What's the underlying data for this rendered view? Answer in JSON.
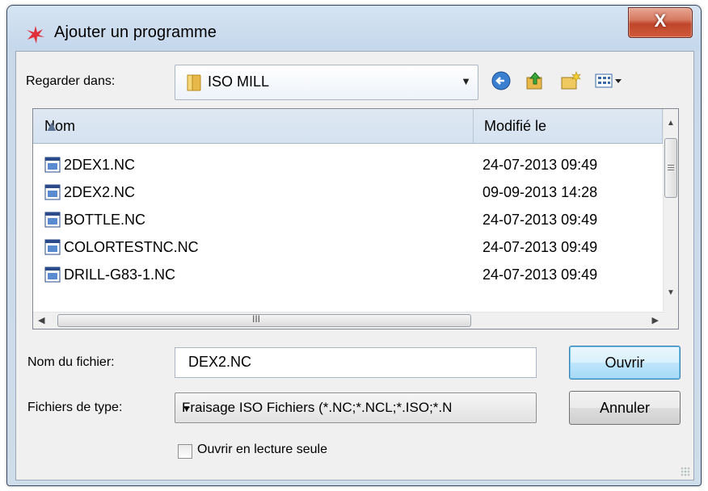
{
  "window": {
    "title": "Ajouter un programme",
    "close_label": "X"
  },
  "lookin": {
    "label": "Regarder dans:",
    "value": "ISO MILL"
  },
  "toolbar": {
    "icons": [
      "back-icon",
      "up-folder-icon",
      "new-folder-icon",
      "view-menu-icon"
    ]
  },
  "list": {
    "columns": [
      "Nom",
      "Modifié le"
    ],
    "rows": [
      {
        "name": "2DEX1.NC",
        "date": "24-07-2013 09:49"
      },
      {
        "name": "2DEX2.NC",
        "date": "09-09-2013 14:28"
      },
      {
        "name": "BOTTLE.NC",
        "date": "24-07-2013 09:49"
      },
      {
        "name": "COLORTESTNC.NC",
        "date": "24-07-2013 09:49"
      },
      {
        "name": "DRILL-G83-1.NC",
        "date": "24-07-2013 09:49"
      }
    ]
  },
  "filename": {
    "label": "Nom du fichier:",
    "value": "DEX2.NC"
  },
  "filetype": {
    "label": "Fichiers de type:",
    "value": "Fraisage ISO Fichiers (*.NC;*.NCL;*.ISO;*.N"
  },
  "buttons": {
    "open": "Ouvrir",
    "cancel": "Annuler"
  },
  "readonly": {
    "label": "Ouvrir en lecture seule",
    "checked": false
  },
  "colors": {
    "accent": "#3c7fb1",
    "close": "#c0452a",
    "folder": "#e8b84a"
  }
}
